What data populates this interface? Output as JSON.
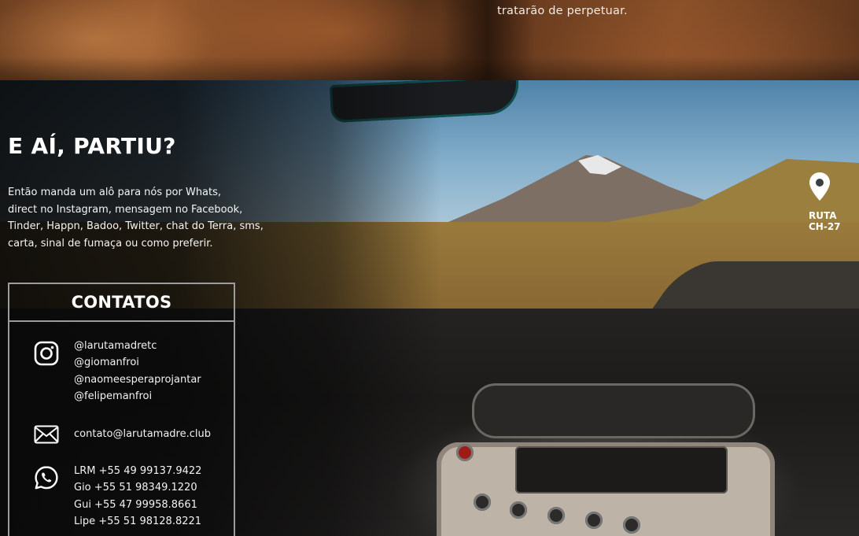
{
  "top_section": {
    "caption": "tratarão de perpetuar."
  },
  "hero": {
    "headline": "E AÍ, PARTIU?",
    "intro_lines": [
      "Então manda um alô para nós por Whats,",
      "direct no Instagram, mensagem no Facebook,",
      "Tinder, Happn, Badoo, Twitter, chat do Terra, sms,",
      "carta, sinal de fumaça ou como preferir."
    ]
  },
  "location": {
    "icon": "map-pin-icon",
    "label_line1": "RUTA",
    "label_line2": "CH-27"
  },
  "contacts": {
    "title": "CONTATOS",
    "instagram": {
      "icon": "instagram-icon",
      "handles": [
        "@larutamadretc",
        "@giomanfroi",
        "@naomeesperaprojantar",
        "@felipemanfroi"
      ]
    },
    "email": {
      "icon": "envelope-icon",
      "address": "contato@larutamadre.club"
    },
    "whatsapp": {
      "icon": "whatsapp-icon",
      "phones": [
        "LRM +55 49 99137.9422",
        "Gio +55 51 98349.1220",
        "Gui +55 47 99958.8661",
        "Lipe +55 51 98128.8221"
      ]
    }
  },
  "colors": {
    "text": "#ffffff",
    "box_border": "#9c9c9c",
    "overlay": "#080808"
  }
}
